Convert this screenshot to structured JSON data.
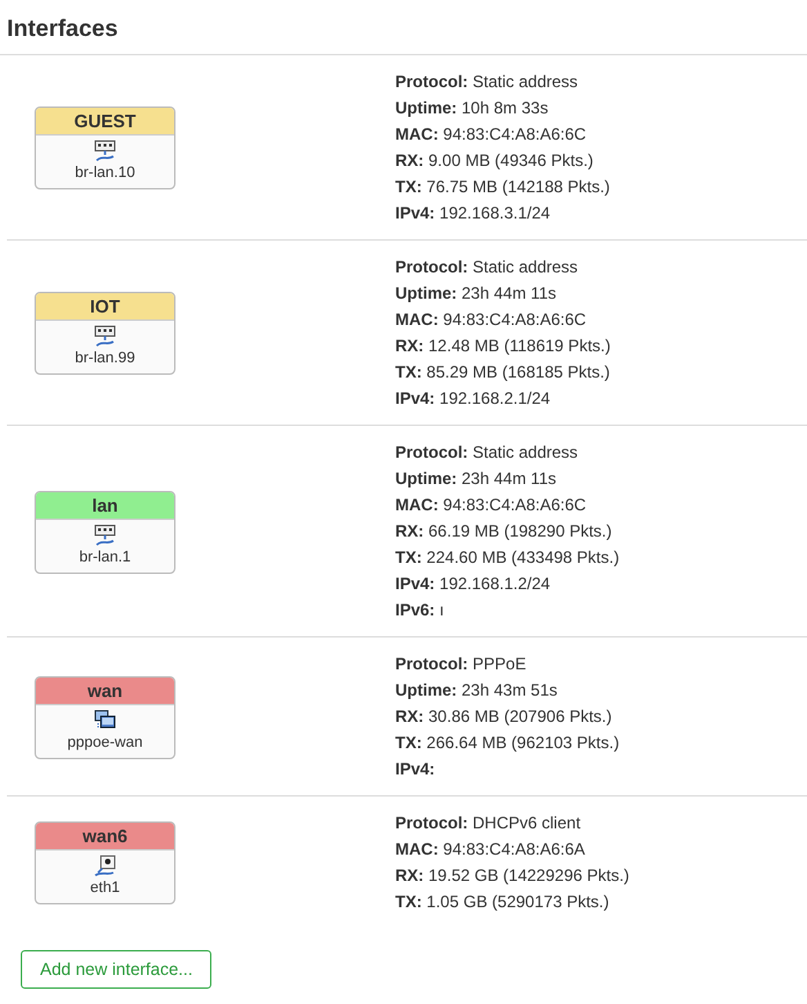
{
  "title": "Interfaces",
  "interfaces": [
    {
      "name": "GUEST",
      "color": "#f6e08f",
      "kind": "bridge",
      "device": "br-lan.10",
      "info": [
        {
          "label": "Protocol:",
          "value": "Static address"
        },
        {
          "label": "Uptime:",
          "value": "10h 8m 33s"
        },
        {
          "label": "MAC:",
          "value": "94:83:C4:A8:A6:6C"
        },
        {
          "label": "RX:",
          "value": "9.00 MB (49346 Pkts.)"
        },
        {
          "label": "TX:",
          "value": "76.75 MB (142188 Pkts.)"
        },
        {
          "label": "IPv4:",
          "value": "192.168.3.1/24"
        }
      ]
    },
    {
      "name": "IOT",
      "color": "#f6e08f",
      "kind": "bridge",
      "device": "br-lan.99",
      "info": [
        {
          "label": "Protocol:",
          "value": "Static address"
        },
        {
          "label": "Uptime:",
          "value": "23h 44m 11s"
        },
        {
          "label": "MAC:",
          "value": "94:83:C4:A8:A6:6C"
        },
        {
          "label": "RX:",
          "value": "12.48 MB (118619 Pkts.)"
        },
        {
          "label": "TX:",
          "value": "85.29 MB (168185 Pkts.)"
        },
        {
          "label": "IPv4:",
          "value": "192.168.2.1/24"
        }
      ]
    },
    {
      "name": "lan",
      "color": "#90ee90",
      "kind": "bridge",
      "device": "br-lan.1",
      "info": [
        {
          "label": "Protocol:",
          "value": "Static address"
        },
        {
          "label": "Uptime:",
          "value": "23h 44m 11s"
        },
        {
          "label": "MAC:",
          "value": "94:83:C4:A8:A6:6C"
        },
        {
          "label": "RX:",
          "value": "66.19 MB (198290 Pkts.)"
        },
        {
          "label": "TX:",
          "value": "224.60 MB (433498 Pkts.)"
        },
        {
          "label": "IPv4:",
          "value": "192.168.1.2/24"
        },
        {
          "label": "IPv6:",
          "value": "ı"
        }
      ]
    },
    {
      "name": "wan",
      "color": "#ea8a8a",
      "kind": "tunnel",
      "device": "pppoe-wan",
      "info": [
        {
          "label": "Protocol:",
          "value": "PPPoE"
        },
        {
          "label": "Uptime:",
          "value": "23h 43m 51s"
        },
        {
          "label": "RX:",
          "value": "30.86 MB (207906 Pkts.)"
        },
        {
          "label": "TX:",
          "value": "266.64 MB (962103 Pkts.)"
        },
        {
          "label": "IPv4:"
        }
      ]
    },
    {
      "name": "wan6",
      "color": "#ea8a8a",
      "kind": "port",
      "device": "eth1",
      "info": [
        {
          "label": "Protocol:",
          "value": "DHCPv6 client"
        },
        {
          "label": "MAC:",
          "value": "94:83:C4:A8:A6:6A"
        },
        {
          "label": "RX:",
          "value": "19.52 GB (14229296 Pkts.)"
        },
        {
          "label": "TX:",
          "value": "1.05 GB (5290173 Pkts.)"
        }
      ]
    }
  ],
  "add_button": "Add new interface..."
}
